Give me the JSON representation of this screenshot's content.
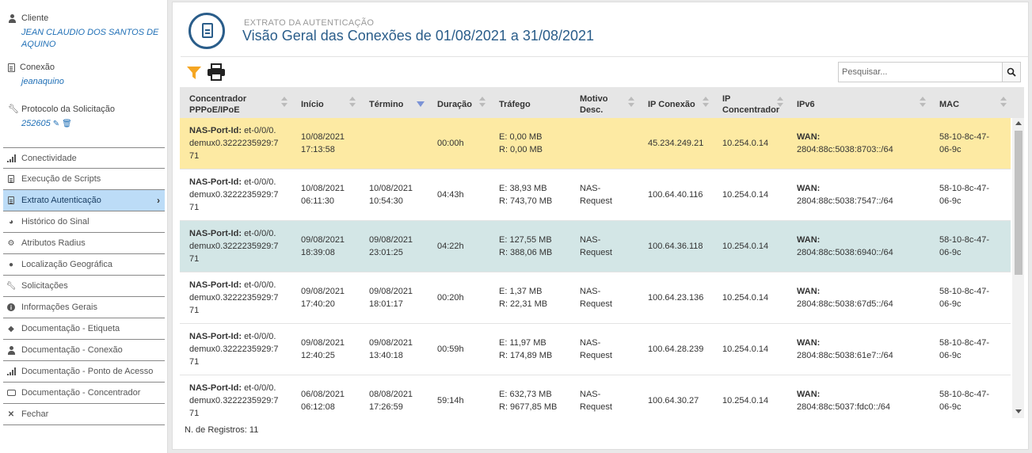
{
  "sidebar": {
    "client_label": "Cliente",
    "client_name": "JEAN CLAUDIO DOS SANTOS DE AQUINO",
    "connection_label": "Conexão",
    "connection_value": "jeanaquino",
    "protocol_label": "Protocolo da Solicitação",
    "protocol_value": "252605",
    "menu": [
      {
        "label": "Conectividade",
        "icon": "signal-icon"
      },
      {
        "label": "Execução de Scripts",
        "icon": "file-icon"
      },
      {
        "label": "Extrato Autenticação",
        "icon": "document-icon",
        "active": true
      },
      {
        "label": "Histórico do Sinal",
        "icon": "gauge-icon"
      },
      {
        "label": "Atributos Radius",
        "icon": "gear-icon"
      },
      {
        "label": "Localização Geográfica",
        "icon": "globe-icon"
      },
      {
        "label": "Solicitações",
        "icon": "wrench-icon"
      },
      {
        "label": "Informações Gerais",
        "icon": "info-icon"
      },
      {
        "label": "Documentação - Etiqueta",
        "icon": "tag-icon"
      },
      {
        "label": "Documentação - Conexão",
        "icon": "user-icon"
      },
      {
        "label": "Documentação - Ponto de Acesso",
        "icon": "signal-icon"
      },
      {
        "label": "Documentação - Concentrador",
        "icon": "drive-icon"
      },
      {
        "label": "Fechar",
        "icon": "close-icon"
      }
    ]
  },
  "header": {
    "subtitle": "EXTRATO DA AUTENTICAÇÃO",
    "title": "Visão Geral das Conexões de 01/08/2021 a 31/08/2021"
  },
  "search": {
    "placeholder": "Pesquisar...",
    "value": ""
  },
  "table": {
    "columns": [
      {
        "l1": "Concentrador",
        "l2": "PPPoE/IPoE"
      },
      {
        "l1": "Início",
        "l2": ""
      },
      {
        "l1": "Término",
        "l2": ""
      },
      {
        "l1": "Duração",
        "l2": ""
      },
      {
        "l1": "Tráfego",
        "l2": ""
      },
      {
        "l1": "Motivo",
        "l2": "Desc."
      },
      {
        "l1": "IP Conexão",
        "l2": ""
      },
      {
        "l1": "IP",
        "l2": "Concentrador"
      },
      {
        "l1": "IPv6",
        "l2": ""
      },
      {
        "l1": "MAC",
        "l2": ""
      }
    ],
    "rows": [
      {
        "nas_label": "NAS-Port-Id:",
        "nas_a": "et-0/0/0.",
        "nas_b": "demux0.3222235929:7",
        "nas_c": "71",
        "start_d": "10/08/2021",
        "start_t": "17:13:58",
        "end_d": "",
        "end_t": "",
        "duration": "00:00h",
        "traffic_e": "E: 0,00 MB",
        "traffic_r": "R: 0,00 MB",
        "reason_a": "",
        "reason_b": "",
        "ip": "45.234.249.21",
        "ip_conc": "10.254.0.14",
        "ipv6_label": "WAN:",
        "ipv6": "2804:88c:5038:8703::/64",
        "mac_a": "58-10-8c-47-",
        "mac_b": "06-9c",
        "style": "yellow"
      },
      {
        "nas_label": "NAS-Port-Id:",
        "nas_a": "et-0/0/0.",
        "nas_b": "demux0.3222235929:7",
        "nas_c": "71",
        "start_d": "10/08/2021",
        "start_t": "06:11:30",
        "end_d": "10/08/2021",
        "end_t": "10:54:30",
        "duration": "04:43h",
        "traffic_e": "E: 38,93 MB",
        "traffic_r": "R: 743,70 MB",
        "reason_a": "NAS-",
        "reason_b": "Request",
        "ip": "100.64.40.116",
        "ip_conc": "10.254.0.14",
        "ipv6_label": "WAN:",
        "ipv6": "2804:88c:5038:7547::/64",
        "mac_a": "58-10-8c-47-",
        "mac_b": "06-9c",
        "style": "white"
      },
      {
        "nas_label": "NAS-Port-Id:",
        "nas_a": "et-0/0/0.",
        "nas_b": "demux0.3222235929:7",
        "nas_c": "71",
        "start_d": "09/08/2021",
        "start_t": "18:39:08",
        "end_d": "09/08/2021",
        "end_t": "23:01:25",
        "duration": "04:22h",
        "traffic_e": "E: 127,55 MB",
        "traffic_r": "R: 388,06 MB",
        "reason_a": "NAS-",
        "reason_b": "Request",
        "ip": "100.64.36.118",
        "ip_conc": "10.254.0.14",
        "ipv6_label": "WAN:",
        "ipv6": "2804:88c:5038:6940::/64",
        "mac_a": "58-10-8c-47-",
        "mac_b": "06-9c",
        "style": "teal"
      },
      {
        "nas_label": "NAS-Port-Id:",
        "nas_a": "et-0/0/0.",
        "nas_b": "demux0.3222235929:7",
        "nas_c": "71",
        "start_d": "09/08/2021",
        "start_t": "17:40:20",
        "end_d": "09/08/2021",
        "end_t": "18:01:17",
        "duration": "00:20h",
        "traffic_e": "E: 1,37 MB",
        "traffic_r": "R: 22,31 MB",
        "reason_a": "NAS-",
        "reason_b": "Request",
        "ip": "100.64.23.136",
        "ip_conc": "10.254.0.14",
        "ipv6_label": "WAN:",
        "ipv6": "2804:88c:5038:67d5::/64",
        "mac_a": "58-10-8c-47-",
        "mac_b": "06-9c",
        "style": "white"
      },
      {
        "nas_label": "NAS-Port-Id:",
        "nas_a": "et-0/0/0.",
        "nas_b": "demux0.3222235929:7",
        "nas_c": "71",
        "start_d": "09/08/2021",
        "start_t": "12:40:25",
        "end_d": "09/08/2021",
        "end_t": "13:40:18",
        "duration": "00:59h",
        "traffic_e": "E: 11,97 MB",
        "traffic_r": "R: 174,89 MB",
        "reason_a": "NAS-",
        "reason_b": "Request",
        "ip": "100.64.28.239",
        "ip_conc": "10.254.0.14",
        "ipv6_label": "WAN:",
        "ipv6": "2804:88c:5038:61e7::/64",
        "mac_a": "58-10-8c-47-",
        "mac_b": "06-9c",
        "style": "white"
      },
      {
        "nas_label": "NAS-Port-Id:",
        "nas_a": "et-0/0/0.",
        "nas_b": "demux0.3222235929:7",
        "nas_c": "71",
        "start_d": "06/08/2021",
        "start_t": "06:12:08",
        "end_d": "08/08/2021",
        "end_t": "17:26:59",
        "duration": "59:14h",
        "traffic_e": "E: 632,73 MB",
        "traffic_r": "R: 9677,85 MB",
        "reason_a": "NAS-",
        "reason_b": "Request",
        "ip": "100.64.30.27",
        "ip_conc": "10.254.0.14",
        "ipv6_label": "WAN:",
        "ipv6": "2804:88c:5037:fdc0::/64",
        "mac_a": "58-10-8c-47-",
        "mac_b": "06-9c",
        "style": "white"
      }
    ]
  },
  "footer": {
    "records": "N. de Registros: 11"
  },
  "colors": {
    "accent": "#2a5d8a",
    "link": "#1f6fb6",
    "active_menu": "#bcdcf7",
    "row_highlight_yellow": "#fdeaa3",
    "row_highlight_teal": "#d3e6e6",
    "filter": "#f5a623"
  }
}
